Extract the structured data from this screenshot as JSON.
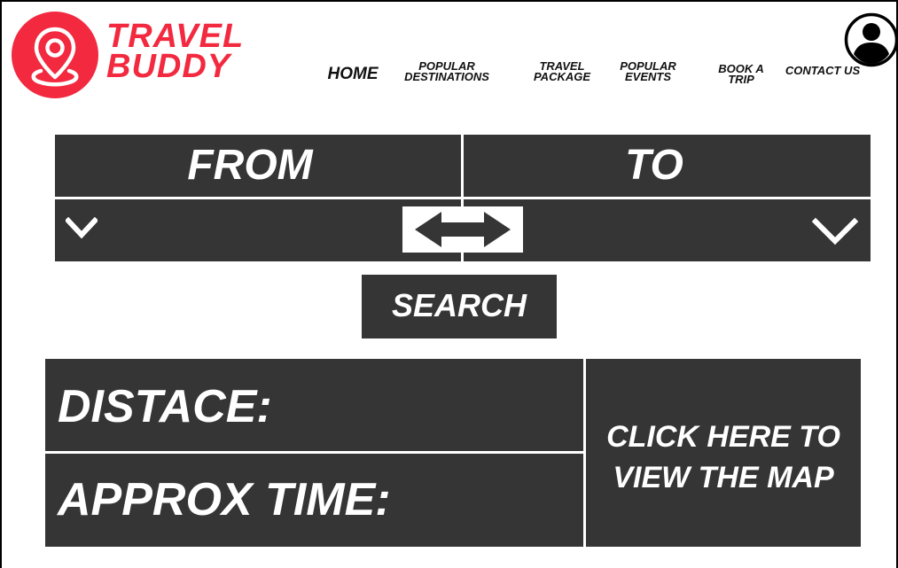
{
  "brand": {
    "line1": "TRAVEL",
    "line2": "BUDDY",
    "accent_color": "#f2293f",
    "logo_icon": "map-pin-icon"
  },
  "nav": {
    "home": "HOME",
    "popular_destinations_1": "POPULAR",
    "popular_destinations_2": "DESTINATIONS",
    "travel_package_1": "TRAVEL",
    "travel_package_2": "PACKAGE",
    "popular_events_1": "POPULAR",
    "popular_events_2": "EVENTS",
    "book_trip_1": "BOOK A",
    "book_trip_2": "TRIP",
    "contact": "CONTACT US",
    "profile_icon": "user-avatar-icon"
  },
  "route": {
    "from_label": "FROM",
    "to_label": "TO",
    "dropdown_icon": "chevron-down-icon",
    "swap_icon": "swap-arrows-icon",
    "search_label": "SEARCH"
  },
  "result": {
    "distance_label": "DISTACE:",
    "time_label": "APPROX TIME:",
    "map_line1": "CLICK HERE TO",
    "map_line2": "VIEW THE MAP"
  },
  "colors": {
    "panel": "#353535",
    "background": "#ffffff",
    "text_light": "#ffffff"
  }
}
